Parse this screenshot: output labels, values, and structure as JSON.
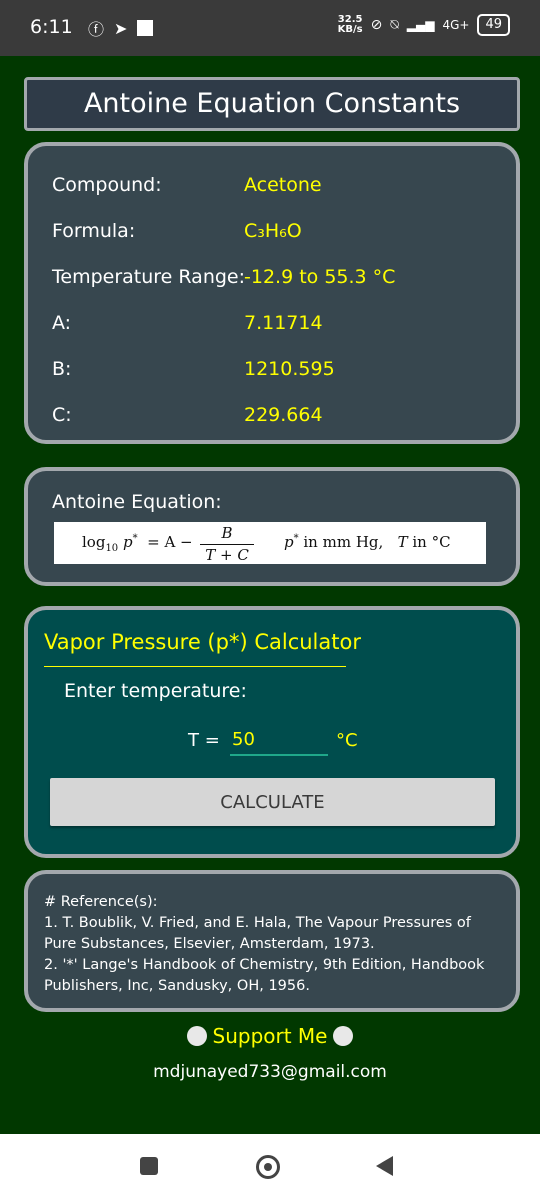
{
  "status_bar": {
    "time": "6:11",
    "speed_value": "32.5",
    "speed_unit": "KB/s",
    "network": "4G+",
    "battery": "49"
  },
  "header": {
    "title": "Antoine Equation Constants"
  },
  "constants": {
    "compound_label": "Compound:",
    "compound_value": "Acetone",
    "formula_label": "Formula:",
    "formula_value": "C₃H₆O",
    "temp_range_label": "Temperature Range:",
    "temp_range_value": "-12.9 to 55.3 °C",
    "a_label": "A:",
    "a_value": "7.11714",
    "b_label": "B:",
    "b_value": "1210.595",
    "c_label": "C:",
    "c_value": "229.664"
  },
  "equation": {
    "label": "Antoine Equation:",
    "lhs": "log",
    "lhs_sub": "10",
    "p_var": "p",
    "p_sup": "*",
    "minus": "= A −",
    "frac_num": "B",
    "frac_den": "T + C",
    "rhs_a": "p",
    "rhs_a_sup": "*",
    "rhs_b": " in mm Hg,",
    "rhs_c": "T",
    "rhs_d": " in °C"
  },
  "calculator": {
    "title": "Vapor Pressure (p*) Calculator",
    "enter_label": "Enter temperature:",
    "t_prefix": "T =",
    "t_value": "50",
    "t_unit": "°C",
    "button_label": "CALCULATE"
  },
  "references": {
    "heading": "# Reference(s):",
    "ref1": "1. T. Boublik, V. Fried, and E. Hala, The Vapour Pressures of Pure Substances, Elsevier, Amsterdam, 1973.",
    "ref2": "2. '*' Lange's Handbook of Chemistry, 9th Edition, Handbook Publishers, Inc, Sandusky, OH, 1956."
  },
  "footer": {
    "support_label": "Support Me",
    "email": "mdjunayed733@gmail.com"
  },
  "colors": {
    "background": "#013800",
    "panel": "#37474f",
    "calc_panel": "#004d4d",
    "accent_yellow": "#ffff00"
  }
}
